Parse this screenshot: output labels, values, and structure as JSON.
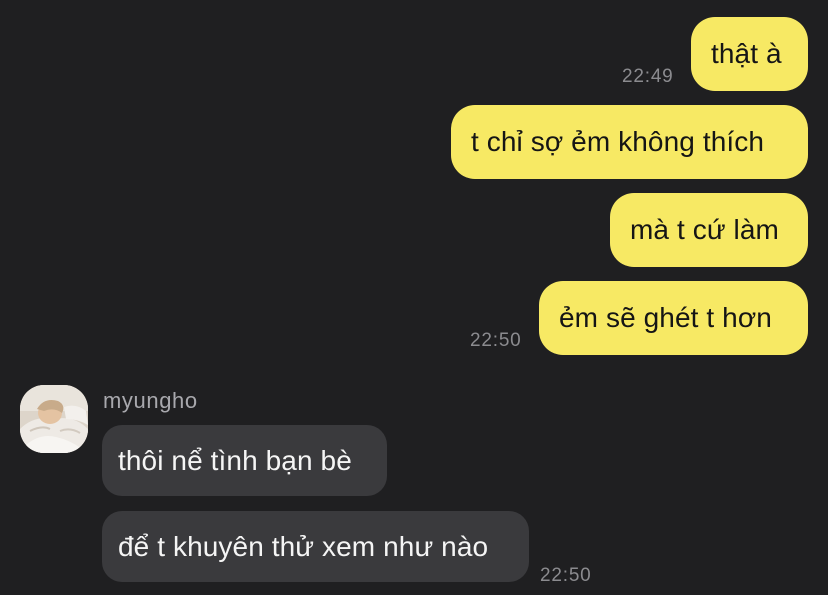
{
  "conversation": {
    "sent": {
      "m1": "thật à",
      "m2": "t chỉ sợ ẻm không thích",
      "m3": "mà t cứ làm",
      "m4": "ẻm sẽ ghét t hơn",
      "time_1": "22:49",
      "time_2": "22:50"
    },
    "received": {
      "sender": "myungho",
      "m1": "thôi nể tình bạn bè",
      "m2": "để t khuyên thử xem như nào",
      "time": "22:50"
    },
    "colors": {
      "background": "#1f1f21",
      "outgoing_bubble": "#f7e964",
      "incoming_bubble": "#3a3a3d"
    }
  }
}
